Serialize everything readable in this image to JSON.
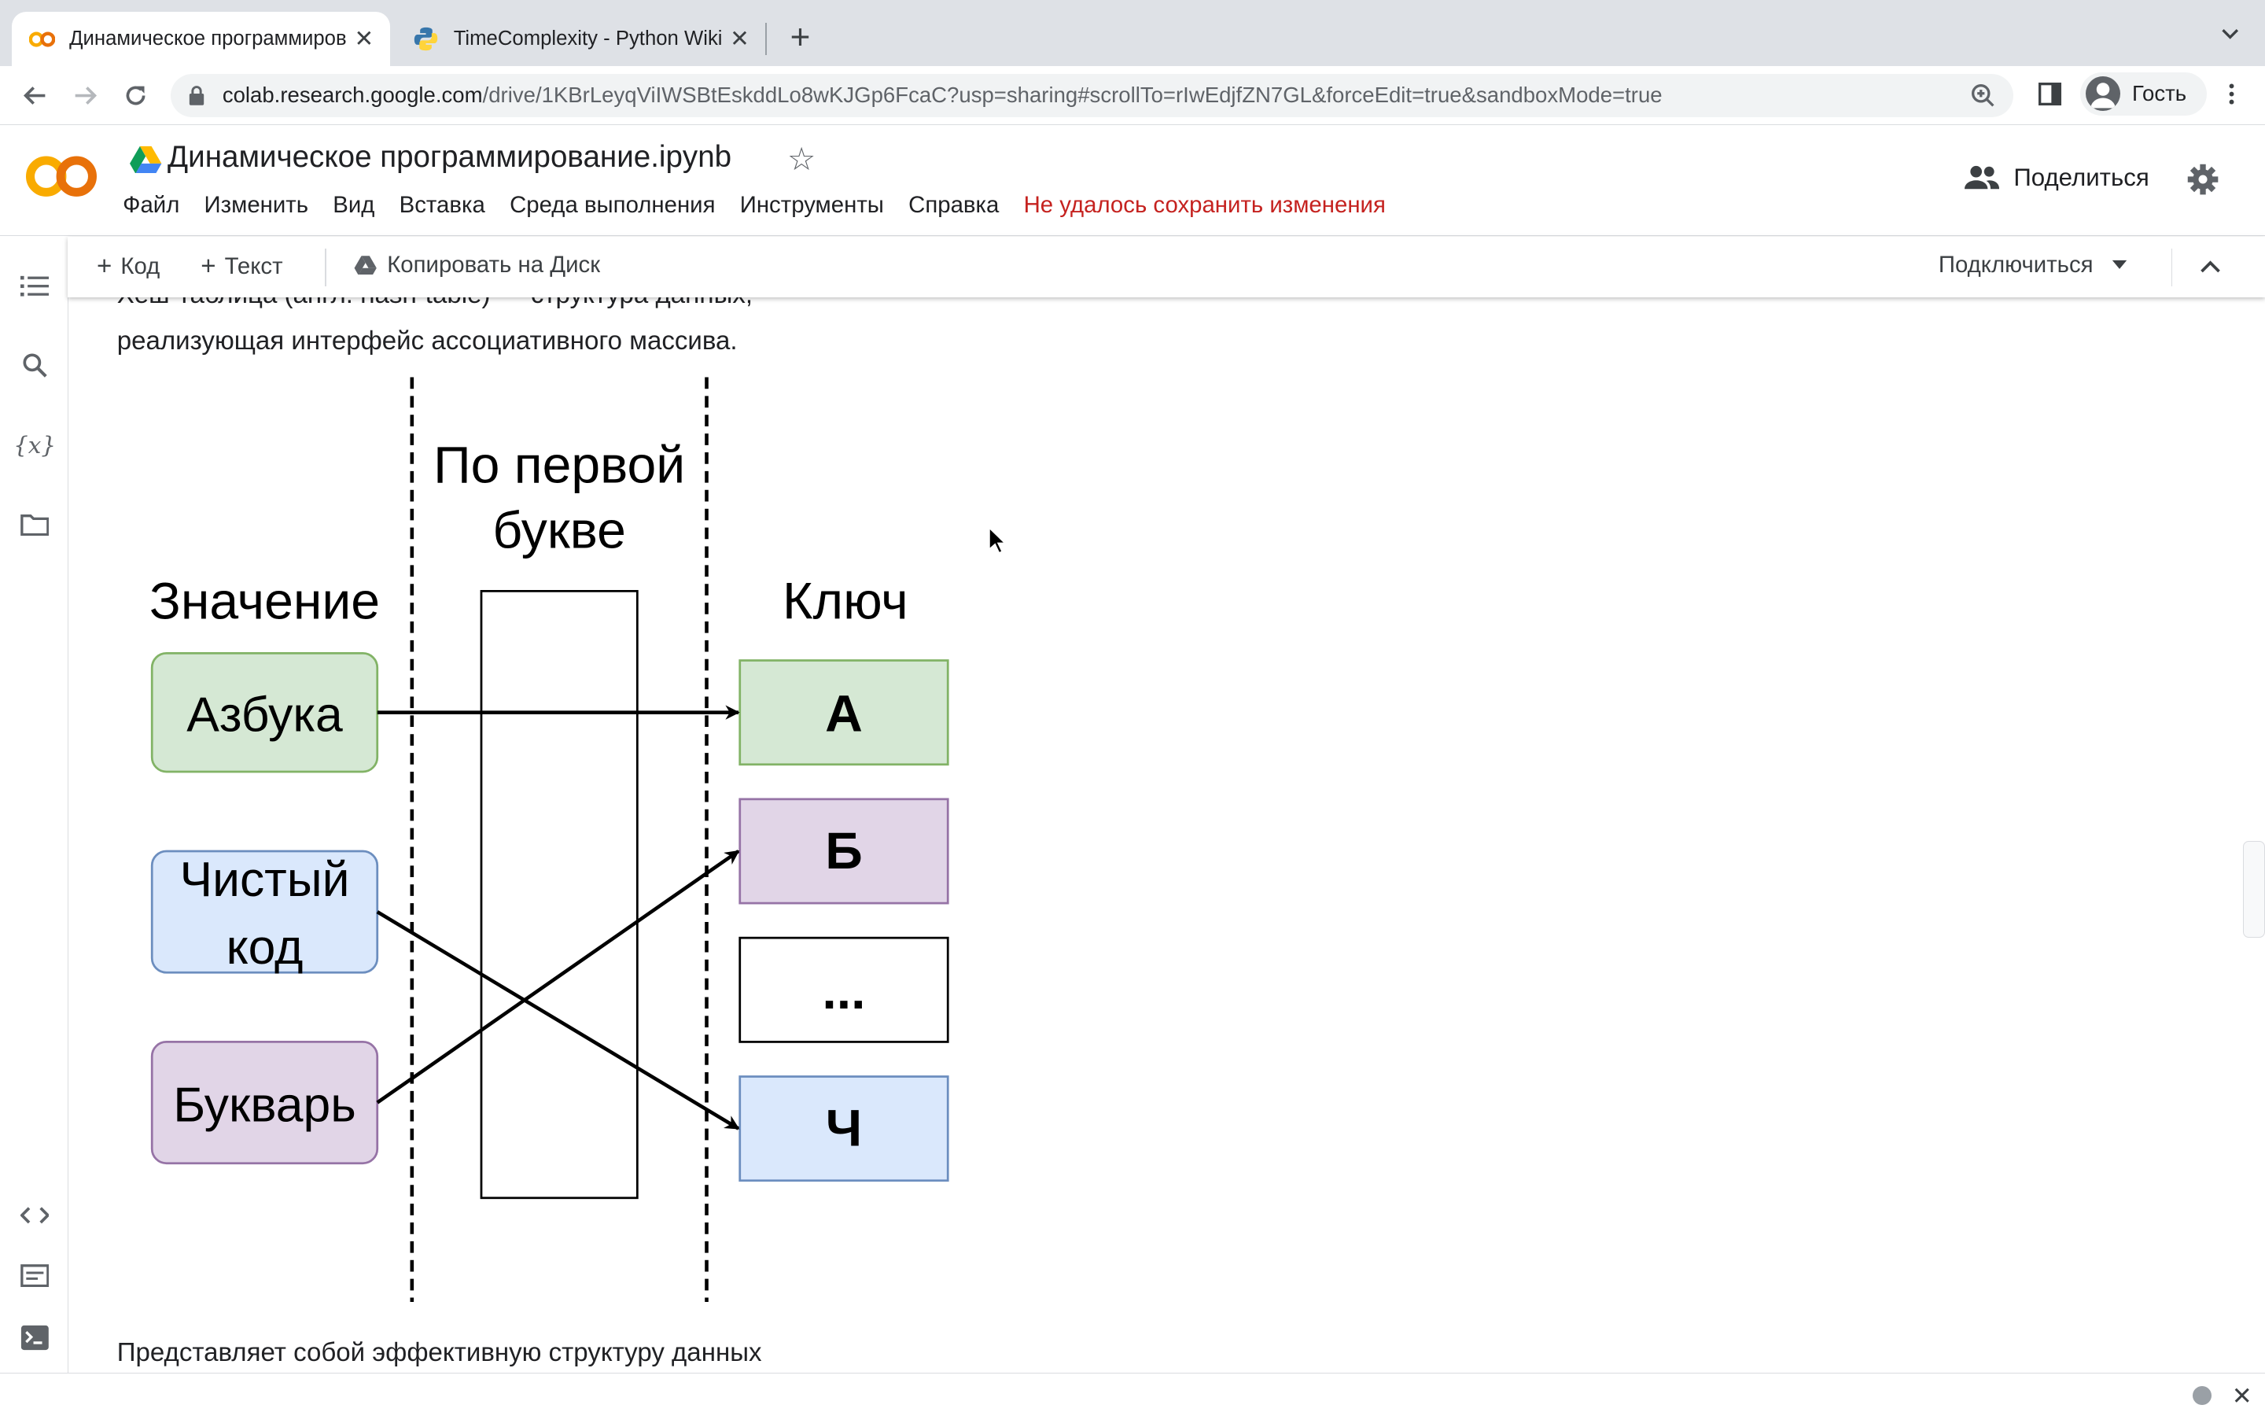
{
  "browser": {
    "tabs": [
      {
        "title": "Динамическое программиров",
        "active": true
      },
      {
        "title": "TimeComplexity - Python Wiki",
        "active": false
      }
    ],
    "url_host": "colab.research.google.com",
    "url_path": "/drive/1KBrLeyqViIWSBtEskddLo8wKJGp6FcaC?usp=sharing#scrollTo=rIwEdjfZN7GL&forceEdit=true&sandboxMode=true",
    "profile_label": "Гость"
  },
  "colab": {
    "logo_text": "CO",
    "notebook_title": "Динамическое программирование.ipynb",
    "menu": [
      "Файл",
      "Изменить",
      "Вид",
      "Вставка",
      "Среда выполнения",
      "Инструменты",
      "Справка"
    ],
    "save_warning": "Не удалось сохранить изменения",
    "share_label": "Поделиться"
  },
  "nb_toolbar": {
    "add_code": "Код",
    "add_text": "Текст",
    "copy_to_drive": "Копировать на Диск",
    "connect": "Подключиться"
  },
  "content": {
    "para_top_line1": "Хеш-таблица (англ. hash-table) — структура данных,",
    "para_top_line2": "реализующая интерфейс ассоциативного массива.",
    "para_bottom": "Представляет собой эффективную структуру данных"
  },
  "diagram": {
    "hash_label_1": "По первой",
    "hash_label_2": "букве",
    "values_header": "Значение",
    "keys_header": "Ключ",
    "values": [
      {
        "label_lines": [
          "Азбука"
        ],
        "fill": "#d5e8d4",
        "stroke": "#82b366"
      },
      {
        "label_lines": [
          "Чистый",
          "код"
        ],
        "fill": "#dae8fc",
        "stroke": "#6c8ebf"
      },
      {
        "label_lines": [
          "Букварь"
        ],
        "fill": "#e1d5e7",
        "stroke": "#9673a6"
      }
    ],
    "keys": [
      {
        "label": "А",
        "fill": "#d5e8d4",
        "stroke": "#82b366"
      },
      {
        "label": "Б",
        "fill": "#e1d5e7",
        "stroke": "#9673a6"
      },
      {
        "label": "...",
        "fill": "#ffffff",
        "stroke": "#000000"
      },
      {
        "label": "Ч",
        "fill": "#dae8fc",
        "stroke": "#6c8ebf"
      }
    ],
    "mapping": [
      {
        "from": "Азбука",
        "to": "А"
      },
      {
        "from": "Чистый код",
        "to": "Ч"
      },
      {
        "from": "Букварь",
        "to": "Б"
      }
    ]
  },
  "colors": {
    "warning": "#c5221f",
    "chrome_tabbar": "#dee1e6",
    "omnibox": "#f1f3f4"
  }
}
